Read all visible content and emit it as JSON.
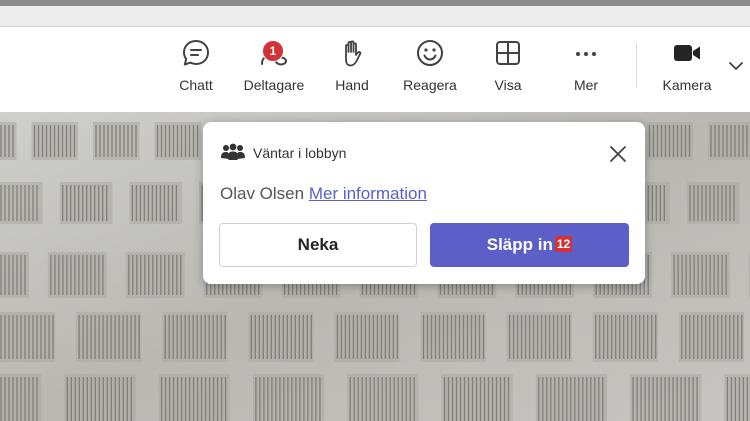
{
  "toolbar": {
    "items": [
      {
        "label": "Chatt",
        "icon": "chat-icon"
      },
      {
        "label": "Deltagare",
        "icon": "people-icon",
        "badge": "1"
      },
      {
        "label": "Hand",
        "icon": "hand-icon"
      },
      {
        "label": "Reagera",
        "icon": "smiley-icon"
      },
      {
        "label": "Visa",
        "icon": "grid-icon"
      },
      {
        "label": "Mer",
        "icon": "more-icon"
      },
      {
        "label": "Kamera",
        "icon": "camera-icon"
      }
    ],
    "badge_color": "#d13438"
  },
  "lobby_popup": {
    "title": "Väntar i lobbyn",
    "person": "Olav Olsen",
    "link": "Mer information",
    "deny_label": "Neka",
    "admit_label": "Släpp in",
    "admit_badge": "12",
    "accent_color": "#5b5fc7"
  }
}
